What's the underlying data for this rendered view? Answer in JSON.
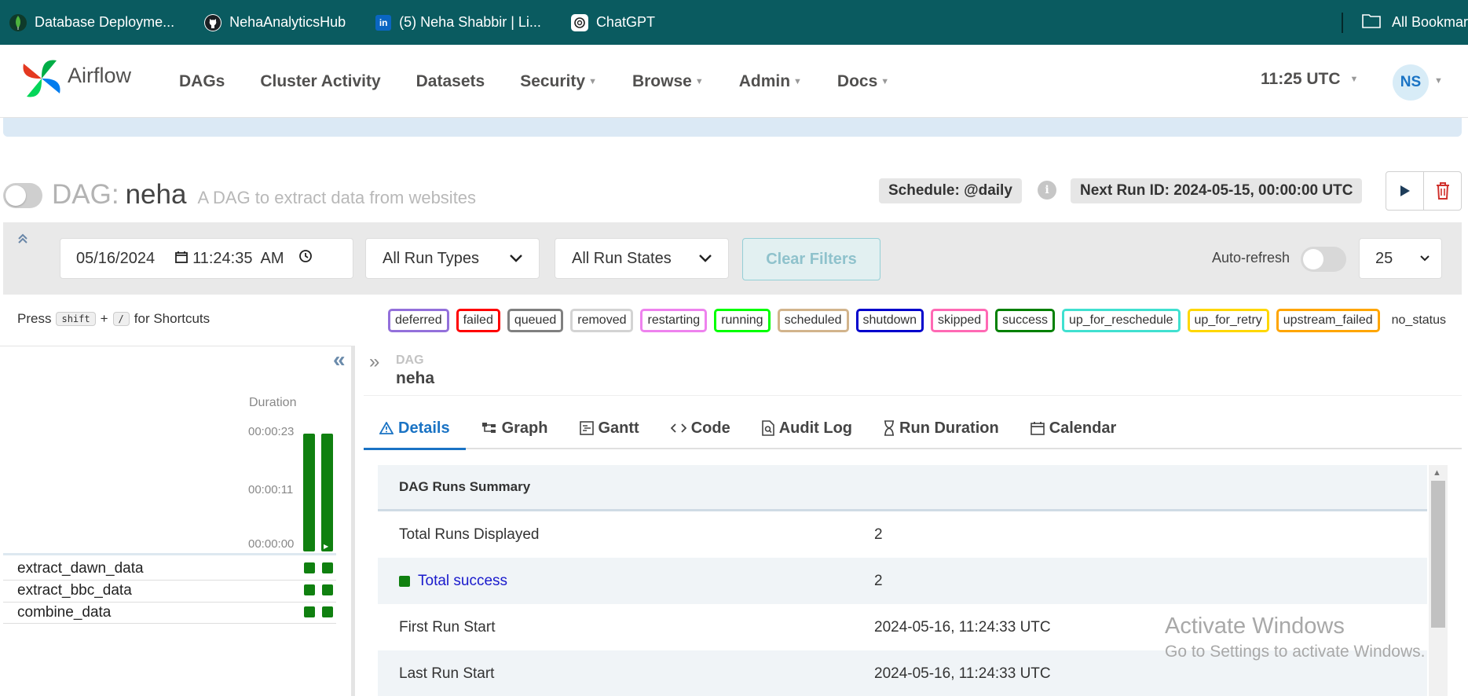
{
  "bookmarks": {
    "items": [
      {
        "label": "Database Deployme...",
        "icon": "mongodb-leaf-icon"
      },
      {
        "label": "NehaAnalyticsHub",
        "icon": "github-icon"
      },
      {
        "label": "(5) Neha Shabbir | Li...",
        "icon": "linkedin-icon"
      },
      {
        "label": "ChatGPT",
        "icon": "chatgpt-icon"
      }
    ],
    "all_bookmarks": "All Bookmar"
  },
  "navbar": {
    "brand": "Airflow",
    "items": [
      "DAGs",
      "Cluster Activity",
      "Datasets",
      "Security",
      "Browse",
      "Admin",
      "Docs"
    ],
    "time": "11:25 UTC",
    "user_initials": "NS",
    "colors": {
      "avatar_bg": "#d8ecf7",
      "avatar_text": "#1a73c4"
    }
  },
  "dag": {
    "prefix": "DAG:",
    "name": "neha",
    "description": "A DAG to extract data from websites",
    "schedule": "Schedule: @daily",
    "info_glyph": "i",
    "next_run": "Next Run ID: 2024-05-15, 00:00:00 UTC"
  },
  "filters": {
    "date": "05/16/2024",
    "time": "11:24:35  AM",
    "run_types": "All Run Types",
    "run_states": "All Run States",
    "clear": "Clear Filters",
    "autorefresh": "Auto-refresh",
    "page_size": "25"
  },
  "shortcuts": {
    "press": "Press",
    "key1": "shift",
    "plus": "+",
    "key2": "/",
    "suffix": "for Shortcuts"
  },
  "legend": {
    "states": [
      {
        "label": "deferred",
        "color": "#9370db"
      },
      {
        "label": "failed",
        "color": "#ff0000"
      },
      {
        "label": "queued",
        "color": "#808080"
      },
      {
        "label": "removed",
        "color": "#d3d3d3"
      },
      {
        "label": "restarting",
        "color": "#ee82ee"
      },
      {
        "label": "running",
        "color": "#00ff00"
      },
      {
        "label": "scheduled",
        "color": "#d2b48c"
      },
      {
        "label": "shutdown",
        "color": "#0000cc"
      },
      {
        "label": "skipped",
        "color": "#ff69b4"
      },
      {
        "label": "success",
        "color": "#008000"
      },
      {
        "label": "up_for_reschedule",
        "color": "#40e0d0"
      },
      {
        "label": "up_for_retry",
        "color": "#ffd700"
      },
      {
        "label": "upstream_failed",
        "color": "#ffa500"
      }
    ],
    "no_status": "no_status"
  },
  "grid": {
    "duration_label": "Duration",
    "ticks": [
      "00:00:23",
      "00:00:11",
      "00:00:00"
    ],
    "run_durations": [
      23,
      23
    ],
    "duration_max": 23,
    "tasks": [
      "extract_dawn_data",
      "extract_bbc_data",
      "combine_data"
    ]
  },
  "details": {
    "dag_label": "DAG",
    "dag_name": "neha",
    "tabs": [
      {
        "label": "Details",
        "icon": "warning-triangle-icon"
      },
      {
        "label": "Graph",
        "icon": "graph-icon"
      },
      {
        "label": "Gantt",
        "icon": "gantt-icon"
      },
      {
        "label": "Code",
        "icon": "code-icon"
      },
      {
        "label": "Audit Log",
        "icon": "audit-log-icon"
      },
      {
        "label": "Run Duration",
        "icon": "hourglass-icon"
      },
      {
        "label": "Calendar",
        "icon": "calendar-icon"
      }
    ],
    "summary_title": "DAG Runs Summary",
    "rows": [
      {
        "key": "Total Runs Displayed",
        "value": "2"
      },
      {
        "key": "Total success",
        "value": "2"
      },
      {
        "key": "First Run Start",
        "value": "2024-05-16, 11:24:33 UTC"
      },
      {
        "key": "Last Run Start",
        "value": "2024-05-16, 11:24:33 UTC"
      }
    ]
  },
  "watermark": {
    "line1": "Activate Windows",
    "line2": "Go to Settings to activate Windows."
  }
}
